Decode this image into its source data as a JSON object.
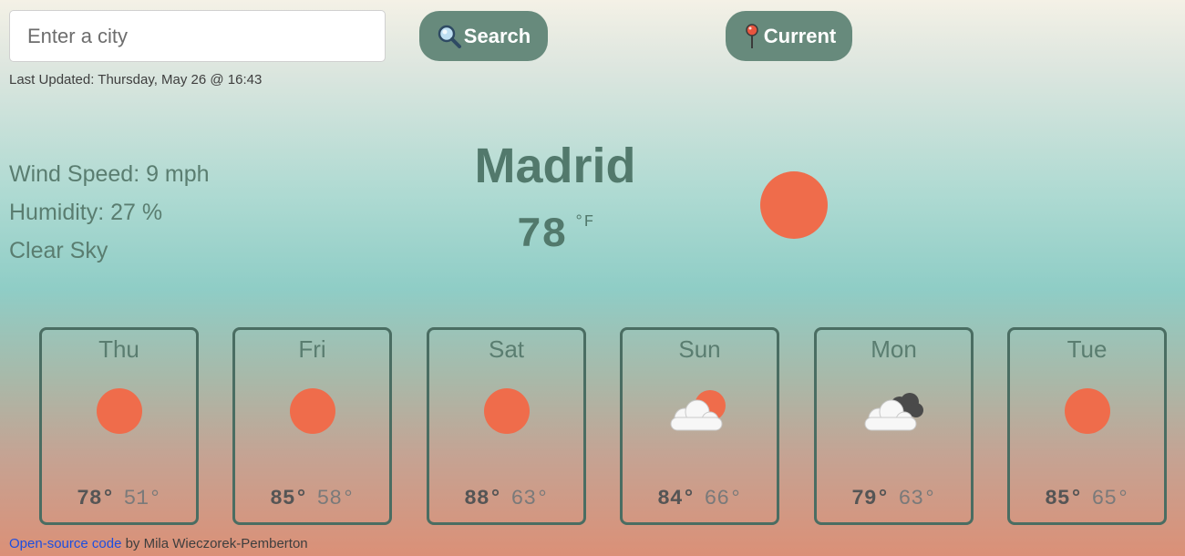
{
  "search": {
    "placeholder": "Enter a city",
    "button_label": "Search"
  },
  "current_button_label": "Current",
  "last_updated": "Last Updated: Thursday, May 26 @ 16:43",
  "details": {
    "wind": "Wind Speed: 9 mph",
    "humidity": "Humidity: 27 %",
    "description": "Clear Sky"
  },
  "city": "Madrid",
  "current_temp": {
    "value": "78",
    "unit": "°F"
  },
  "current_icon": "sun-icon",
  "forecast": [
    {
      "day": "Thu",
      "icon": "sun-icon",
      "high": "78°",
      "low": "51°"
    },
    {
      "day": "Fri",
      "icon": "sun-icon",
      "high": "85°",
      "low": "58°"
    },
    {
      "day": "Sat",
      "icon": "sun-icon",
      "high": "88°",
      "low": "63°"
    },
    {
      "day": "Sun",
      "icon": "partly-cloudy-icon",
      "high": "84°",
      "low": "66°"
    },
    {
      "day": "Mon",
      "icon": "broken-clouds-icon",
      "high": "79°",
      "low": "63°"
    },
    {
      "day": "Tue",
      "icon": "sun-icon",
      "high": "85°",
      "low": "65°"
    }
  ],
  "footer": {
    "link_text": "Open-source code",
    "author_text": " by Mila Wieczorek-Pemberton"
  },
  "colors": {
    "sun": "#ef6c4b",
    "button": "#678a7c",
    "accent_text": "#52796c",
    "card_border": "#4a6d62",
    "link": "#1d4ee0"
  }
}
